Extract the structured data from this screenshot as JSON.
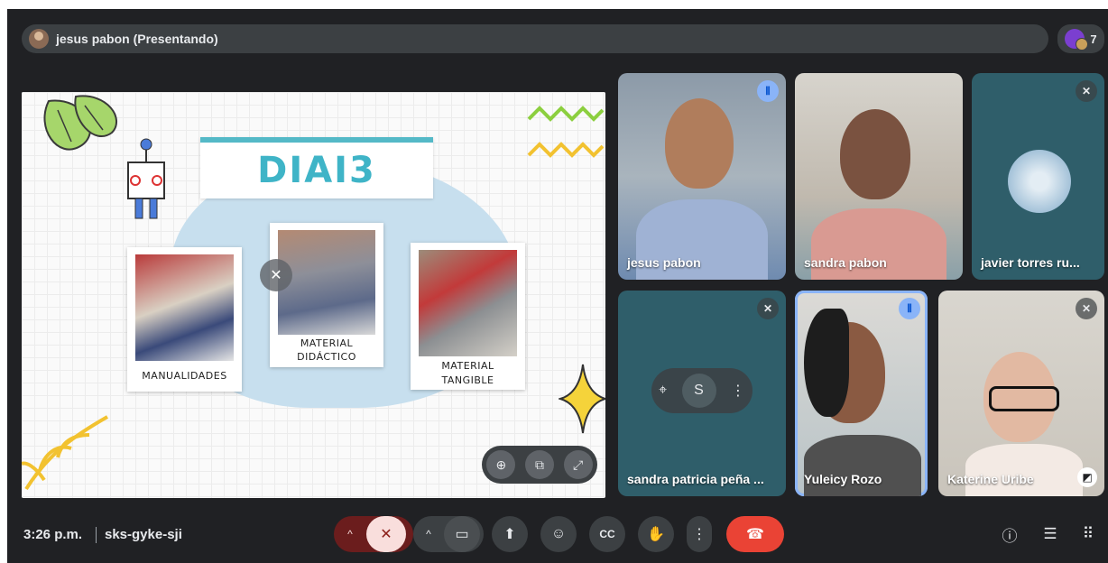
{
  "header": {
    "presenter_label": "jesus pabon (Presentando)",
    "participant_count": "7"
  },
  "slide": {
    "title": "DIAI3",
    "cards": [
      {
        "caption": "MANUALIDADES"
      },
      {
        "caption_line1": "MATERIAL",
        "caption_line2": "DIDÁCTICO"
      },
      {
        "caption_line1": "MATERIAL",
        "caption_line2": "TANGIBLE"
      }
    ]
  },
  "tiles": [
    {
      "name": "jesus pabon",
      "status": "speaking"
    },
    {
      "name": "sandra pabon",
      "status": "none"
    },
    {
      "name": "javier torres ru...",
      "status": "muted"
    },
    {
      "name": "sandra patricia peña ...",
      "status": "muted"
    },
    {
      "name": "Yuleicy Rozo",
      "status": "speaking"
    },
    {
      "name": "Katerine Uribe",
      "status": "muted"
    }
  ],
  "footer": {
    "time": "3:26 p.m.",
    "meeting_code": "sks-gyke-sji"
  },
  "colors": {
    "background": "#202124",
    "hangup": "#ea4335",
    "mic_muted": "#f9dedc",
    "speaking_border": "#8ab4f8"
  }
}
